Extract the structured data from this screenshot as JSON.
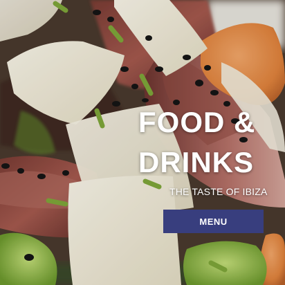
{
  "hero": {
    "title_line1": "FOOD &",
    "title_line2": "DRINKS",
    "subtitle": "THE TASTE OF IBIZA",
    "button_label": "MENU"
  },
  "colors": {
    "button_bg": "#383e7e",
    "text": "#ffffff"
  }
}
